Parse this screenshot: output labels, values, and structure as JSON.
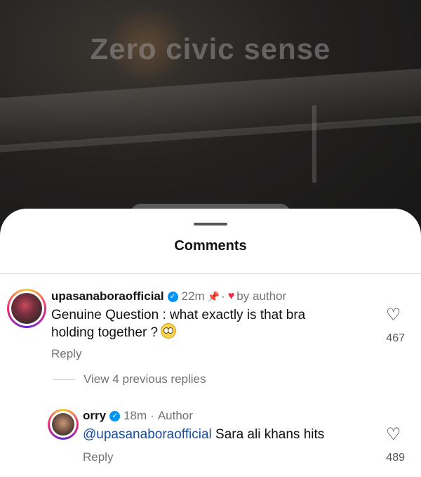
{
  "video": {
    "overlay_text": "Zero civic sense"
  },
  "sheet": {
    "title": "Comments"
  },
  "comments": [
    {
      "username": "upasanaboraofficial",
      "time": "22m",
      "pinned_icon": "pin-icon",
      "liked_by": "by author",
      "text_line1": "Genuine Question : what exactly is that bra",
      "text_line2": "holding together ?",
      "emoji": "pleading-face-emoji",
      "likes": "467",
      "reply_label": "Reply",
      "view_replies": "View 4 previous replies"
    },
    {
      "username": "orry",
      "time": "18m",
      "author_tag": "Author",
      "mention": "@upasanaboraofficial",
      "text": "Sara ali khans hits",
      "likes": "489",
      "reply_label": "Reply"
    }
  ],
  "colors": {
    "verified": "#0095f6",
    "heart": "#ed2d45",
    "mention": "#1a4fa0",
    "sheet_bg": "#ffffff"
  }
}
